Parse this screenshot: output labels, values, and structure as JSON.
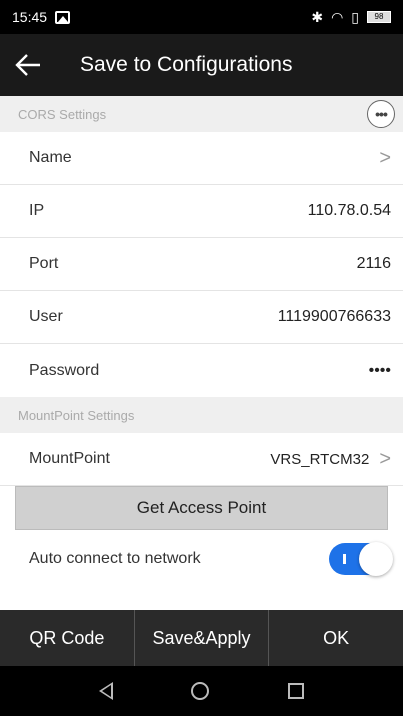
{
  "status_bar": {
    "time": "15:45",
    "battery": "98"
  },
  "appbar": {
    "title": "Save to Configurations",
    "back_icon": "arrow-left"
  },
  "cors_section": {
    "title": "CORS Settings",
    "more_icon": "more-horizontal"
  },
  "fields": {
    "name": {
      "label": "Name",
      "value": ""
    },
    "ip": {
      "label": "IP",
      "value": "110.78.0.54"
    },
    "port": {
      "label": "Port",
      "value": "2116"
    },
    "user": {
      "label": "User",
      "value": "1119900766633"
    },
    "password": {
      "label": "Password",
      "value": "••••"
    }
  },
  "mount_section": {
    "title": "MountPoint Settings"
  },
  "mountpoint": {
    "label": "MountPoint",
    "value": "VRS_RTCM32"
  },
  "access_button": {
    "label": "Get Access Point"
  },
  "auto_connect": {
    "label": "Auto connect to network",
    "enabled": true,
    "accent": "#1e72e8"
  },
  "bottom_bar": {
    "qr_label": "QR Code",
    "save_label": "Save&Apply",
    "ok_label": "OK"
  }
}
